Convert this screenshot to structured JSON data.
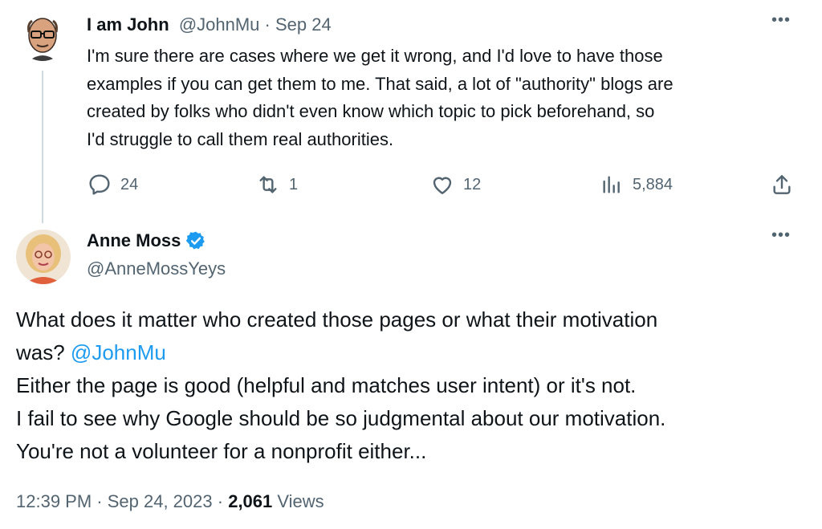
{
  "reply": {
    "author_name": "I am John",
    "author_handle": "@JohnMu",
    "separator": " · ",
    "date": "Sep 24",
    "text_lines": [
      "I'm sure there are cases where we get it wrong, and I'd love to have those",
      "examples if you can get them to me. That said, a lot of \"authority\" blogs are",
      "created by folks who didn't even know which topic to pick beforehand, so",
      "I'd struggle to call them real authorities."
    ],
    "stats": {
      "replies": "24",
      "reposts": "1",
      "likes": "12",
      "views": "5,884"
    },
    "more_icon": "•••"
  },
  "main": {
    "author_name": "Anne Moss",
    "author_handle": "@AnneMossYeys",
    "verified": true,
    "more_icon": "•••",
    "line1": "What does it matter who created those pages or what their motivation",
    "line2_prefix": "was? ",
    "mention": "@JohnMu",
    "line3": "Either the page is good (helpful and matches user intent) or it's not.",
    "line4": "I fail to see why Google should be so judgmental about our motivation.",
    "line5": "You're not a volunteer for a nonprofit either...",
    "time": "12:39 PM",
    "separator": " · ",
    "date": "Sep 24, 2023",
    "views_count": "2,061",
    "views_label": " Views"
  },
  "colors": {
    "accent": "#1d9bf0",
    "muted": "#536471",
    "text": "#0f1419",
    "thread_line": "#cfd9de"
  }
}
